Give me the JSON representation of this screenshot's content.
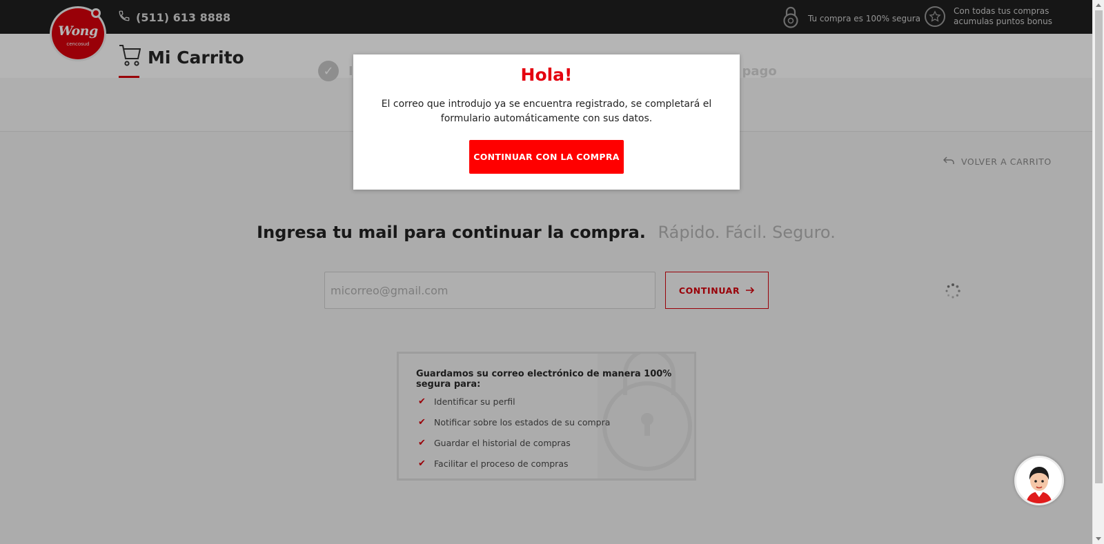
{
  "topbar": {
    "logo_text": "Wong",
    "logo_subtext": "cencosud",
    "phone": "(511) 613 8888",
    "secure_text": "Tu compra es 100% segura",
    "bonus_text_line1": "Con todas tus compras",
    "bonus_text_line2": "acumulas puntos bonus"
  },
  "header": {
    "cart_title": "Mi Carrito"
  },
  "steps": {
    "step1_label": "I",
    "step3_label": "e pago"
  },
  "main": {
    "back_link": "VOLVER A CARRITO",
    "headline_bold": "Ingresa tu mail para continuar la compra.",
    "headline_light": "Rápido. Fácil. Seguro.",
    "email_placeholder": "micorreo@gmail.com",
    "continue_label": "CONTINUAR"
  },
  "info": {
    "title": "Guardamos su correo electrónico de manera 100% segura para:",
    "items": [
      "Identificar su perfil",
      "Notificar sobre los estados de su compra",
      "Guardar el historial de compras",
      "Facilitar el proceso de compras"
    ]
  },
  "modal": {
    "title": "Hola!",
    "message": "El correo que introdujo ya se encuentra registrado, se completará el formulario automáticamente con sus datos.",
    "button_label": "CONTINUAR CON LA COMPRA"
  },
  "colors": {
    "brand_red": "#d8000c",
    "modal_button": "#ff0000",
    "topbar_bg": "#1f1f1f"
  }
}
